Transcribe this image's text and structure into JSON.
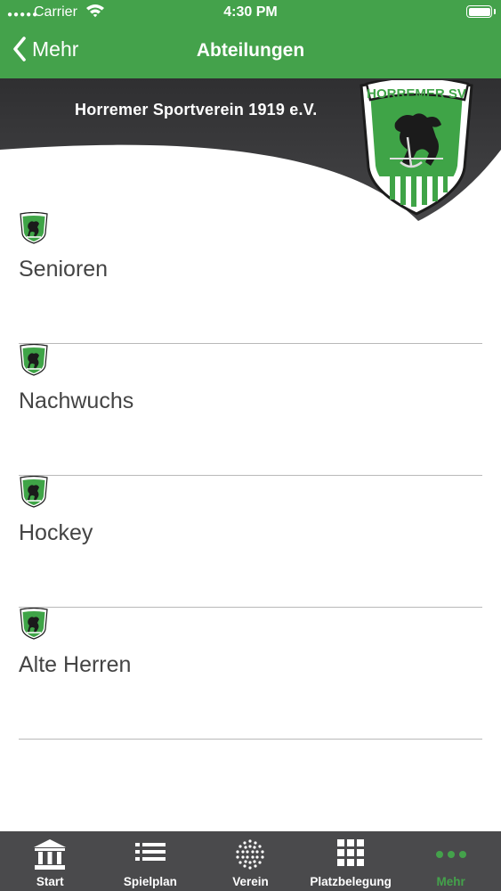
{
  "status": {
    "carrier": "Carrier",
    "time": "4:30 PM"
  },
  "nav": {
    "back_label": "Mehr",
    "title": "Abteilungen"
  },
  "banner": {
    "club_name": "Horremer Sportverein 1919 e.V.",
    "crest_text": "HORREMER SV"
  },
  "departments": [
    {
      "label": "Senioren"
    },
    {
      "label": "Nachwuchs"
    },
    {
      "label": "Hockey"
    },
    {
      "label": "Alte Herren"
    }
  ],
  "tabs": [
    {
      "label": "Start",
      "icon": "bank-icon"
    },
    {
      "label": "Spielplan",
      "icon": "list-icon"
    },
    {
      "label": "Verein",
      "icon": "dot-grid-icon"
    },
    {
      "label": "Platzbelegung",
      "icon": "grid-icon"
    },
    {
      "label": "Mehr",
      "icon": "more-dots-icon",
      "active": true
    }
  ],
  "colors": {
    "accent": "#44a24b",
    "banner": "#3b3b3d",
    "tabbar": "#4a4a4c"
  }
}
